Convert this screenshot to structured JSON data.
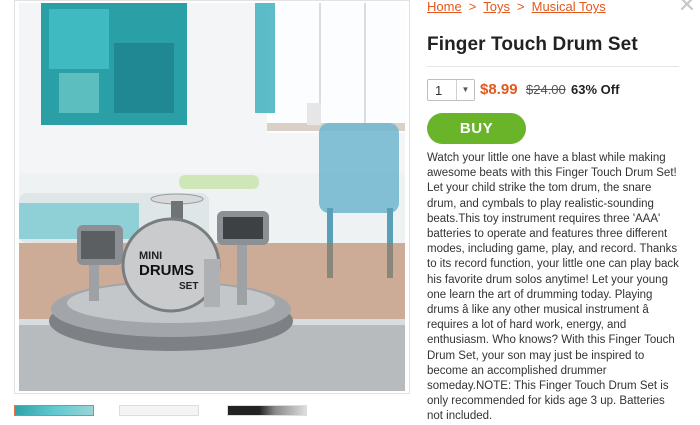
{
  "breadcrumb": {
    "home": "Home",
    "sep": ">",
    "toys": "Toys",
    "musical_toys": "Musical Toys"
  },
  "product": {
    "title": "Finger Touch Drum Set",
    "quantity": "1",
    "price": "$8.99",
    "old_price": "$24.00",
    "discount": "63% Off",
    "buy_label": "BUY",
    "description": "Watch your little one have a blast while making awesome beats with this Finger Touch Drum Set! Let your child strike the tom drum, the snare drum, and cymbals to play realistic-sounding beats.This toy instrument requires three 'AAA' batteries to operate and features three different modes, including game, play, and record. Thanks to its record function, your little one can play back his favorite drum solos anytime! Let your young one learn the art of drumming today. Playing drums â like any other musical instrument â requires a lot of hard work, energy, and enthusiasm. Who knows? With this Finger Touch Drum Set, your son may just be inspired to become an accomplished drummer someday.NOTE: This Finger Touch Drum Set is only recommended for kids age 3 up. Batteries not included."
  },
  "image": {
    "drum_label_line1": "MINI",
    "drum_label_line2": "DRUMS",
    "drum_label_line3": "SET"
  },
  "icons": {
    "close": "close-icon",
    "dropdown": "chevron-down-icon"
  },
  "colors": {
    "accent": "#e2581e",
    "buy": "#6ab42a"
  }
}
